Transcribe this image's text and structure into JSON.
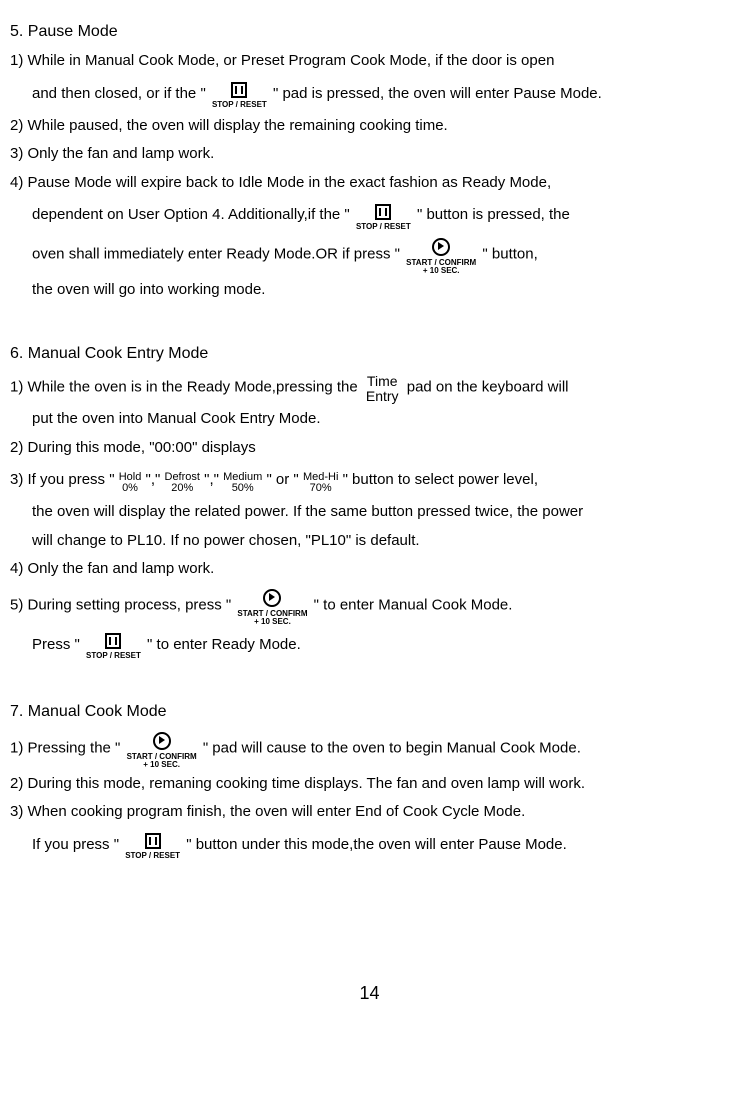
{
  "s5": {
    "title": "5. Pause Mode",
    "i1a": "1) While in Manual Cook Mode, or Preset Program Cook Mode, if the door is open",
    "i1b_pre": "and then closed, or if the \"",
    "i1b_post": "\" pad is pressed, the oven will enter Pause Mode.",
    "i2": "2) While paused, the oven will display the remaining cooking time.",
    "i3": "3) Only the fan and lamp work.",
    "i4a": "4) Pause Mode will expire back to Idle Mode in the exact fashion as Ready Mode,",
    "i4b_pre": "dependent on User Option 4. Additionally,if the \"",
    "i4b_post": "\" button is pressed, the",
    "i4c_pre": "oven shall immediately enter Ready Mode.OR if press \"",
    "i4c_post": "\" button,",
    "i4d": "the oven will go into working mode."
  },
  "s6": {
    "title": "6. Manual Cook Entry Mode",
    "i1a_pre": "1) While the oven is in the Ready Mode,pressing the",
    "i1a_post": "pad on the keyboard will",
    "i1b": "put the oven into Manual Cook Entry Mode.",
    "i2": "2) During this mode, \"00:00\" displays",
    "i3a_pre": "3) If you press \"",
    "comma": "\",\"",
    "or": "\" or \"",
    "i3a_post": "\" button to select power level,",
    "i3b": "the oven will display the related power. If the same button pressed twice, the power",
    "i3c": "will change to PL10. If no power chosen, \"PL10\" is default.",
    "i4": "4) Only the fan and lamp work.",
    "i5a_pre": "5)  During setting process, press \"",
    "i5a_post": "\" to enter Manual Cook Mode.",
    "i5b_pre": "Press \"",
    "i5b_post": "\" to enter Ready Mode."
  },
  "s7": {
    "title": "7. Manual Cook Mode",
    "i1_pre": "1) Pressing  the \"",
    "i1_post": "\" pad will cause to the oven to begin Manual Cook Mode.",
    "i2": "2) During this mode, remaning cooking time displays. The fan and oven lamp will work.",
    "i3a": "3) When cooking program finish, the oven will enter End of Cook Cycle Mode.",
    "i3b_pre": "If you press \"",
    "i3b_post": "\" button under this mode,the oven will enter Pause Mode."
  },
  "icons": {
    "stop_label": "STOP / RESET",
    "start_l1": "START / CONFIRM",
    "start_l2": "+ 10 SEC.",
    "time1": "Time",
    "time2": "Entry",
    "hold_t": "Hold",
    "hold_b": "0%",
    "def_t": "Defrost",
    "def_b": "20%",
    "med_t": "Medium",
    "med_b": "50%",
    "mh_t": "Med-Hi",
    "mh_b": "70%"
  },
  "page": "14"
}
